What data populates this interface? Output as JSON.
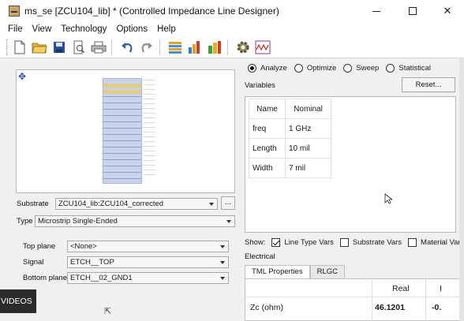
{
  "window": {
    "title": "ms_se [ZCU104_lib] * (Controlled Impedance Line Designer)",
    "minimize": "minimize",
    "maximize": "maximize",
    "close": "✕"
  },
  "menu": [
    "File",
    "View",
    "Technology",
    "Options",
    "Help"
  ],
  "toolbar": [
    "new-file-icon",
    "open-folder-icon",
    "save-icon",
    "print-preview-icon",
    "print-icon",
    "undo-icon",
    "redo-icon",
    "stackup-icon",
    "bar-chart-icon",
    "chart-icon",
    "settings-gear-icon",
    "waveform-icon"
  ],
  "left": {
    "substrate_label": "Substrate",
    "substrate_value": "ZCU104_lib:ZCU104_corrected",
    "browse_label": "...",
    "type_label": "Type",
    "type_value": "Microstrip Single-Ended",
    "top_plane_label": "Top plane",
    "top_plane_value": "<None>",
    "signal_label": "Signal",
    "signal_value": "ETCH__TOP",
    "bottom_plane_label": "Bottom plane",
    "bottom_plane_value": "ETCH__02_GND1"
  },
  "overlay": {
    "videos": "VIDEOS"
  },
  "right": {
    "modes": [
      {
        "label": "Analyze",
        "selected": true
      },
      {
        "label": "Optimize",
        "selected": false
      },
      {
        "label": "Sweep",
        "selected": false
      },
      {
        "label": "Statistical",
        "selected": false
      }
    ],
    "variables_label": "Variables",
    "reset_label": "Reset...",
    "vars_headers": [
      "Name",
      "Nominal"
    ],
    "vars_rows": [
      {
        "name": "freq",
        "nominal": "1 GHz"
      },
      {
        "name": "Length",
        "nominal": "10 mil"
      },
      {
        "name": "Width",
        "nominal": "7 mil"
      }
    ],
    "show_label": "Show:",
    "show_options": [
      {
        "label": "Line Type Vars",
        "checked": true
      },
      {
        "label": "Substrate Vars",
        "checked": false
      },
      {
        "label": "Material Vars",
        "checked": false
      }
    ],
    "electrical_label": "Electrical",
    "tabs": [
      "TML Properties",
      "RLGC"
    ],
    "elec_header_real": "Real",
    "elec_header_imag": "I",
    "elec_row_label": "Zc (ohm)",
    "elec_row_real": "46.1201",
    "elec_row_imag": "-0."
  }
}
